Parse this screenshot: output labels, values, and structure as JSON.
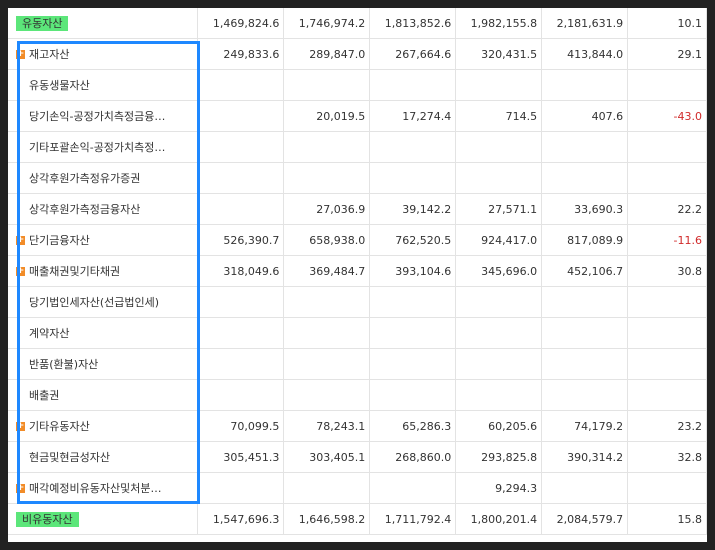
{
  "rows": [
    {
      "label": "유동자산",
      "expandable": false,
      "highlight": true,
      "values": [
        "1,469,824.6",
        "1,746,974.2",
        "1,813,852.6",
        "1,982,155.8",
        "2,181,631.9"
      ],
      "change": "10.1",
      "negative": false
    },
    {
      "label": "재고자산",
      "expandable": true,
      "highlight": false,
      "values": [
        "249,833.6",
        "289,847.0",
        "267,664.6",
        "320,431.5",
        "413,844.0"
      ],
      "change": "29.1",
      "negative": false
    },
    {
      "label": "유동생물자산",
      "expandable": false,
      "highlight": false,
      "values": [
        "",
        "",
        "",
        "",
        ""
      ],
      "change": "",
      "negative": false
    },
    {
      "label": "당기손익-공정가치측정금융…",
      "expandable": false,
      "highlight": false,
      "values": [
        "",
        "20,019.5",
        "17,274.4",
        "714.5",
        "407.6"
      ],
      "change": "-43.0",
      "negative": true
    },
    {
      "label": "기타포괄손익-공정가치측정…",
      "expandable": false,
      "highlight": false,
      "values": [
        "",
        "",
        "",
        "",
        ""
      ],
      "change": "",
      "negative": false
    },
    {
      "label": "상각후원가측정유가증권",
      "expandable": false,
      "highlight": false,
      "values": [
        "",
        "",
        "",
        "",
        ""
      ],
      "change": "",
      "negative": false
    },
    {
      "label": "상각후원가측정금융자산",
      "expandable": false,
      "highlight": false,
      "values": [
        "",
        "27,036.9",
        "39,142.2",
        "27,571.1",
        "33,690.3"
      ],
      "change": "22.2",
      "negative": false
    },
    {
      "label": "단기금융자산",
      "expandable": true,
      "highlight": false,
      "values": [
        "526,390.7",
        "658,938.0",
        "762,520.5",
        "924,417.0",
        "817,089.9"
      ],
      "change": "-11.6",
      "negative": true
    },
    {
      "label": "매출채권및기타채권",
      "expandable": true,
      "highlight": false,
      "values": [
        "318,049.6",
        "369,484.7",
        "393,104.6",
        "345,696.0",
        "452,106.7"
      ],
      "change": "30.8",
      "negative": false
    },
    {
      "label": "당기법인세자산(선급법인세)",
      "expandable": false,
      "highlight": false,
      "values": [
        "",
        "",
        "",
        "",
        ""
      ],
      "change": "",
      "negative": false
    },
    {
      "label": "계약자산",
      "expandable": false,
      "highlight": false,
      "values": [
        "",
        "",
        "",
        "",
        ""
      ],
      "change": "",
      "negative": false
    },
    {
      "label": "반품(환불)자산",
      "expandable": false,
      "highlight": false,
      "values": [
        "",
        "",
        "",
        "",
        ""
      ],
      "change": "",
      "negative": false
    },
    {
      "label": "배출권",
      "expandable": false,
      "highlight": false,
      "values": [
        "",
        "",
        "",
        "",
        ""
      ],
      "change": "",
      "negative": false
    },
    {
      "label": "기타유동자산",
      "expandable": true,
      "highlight": false,
      "values": [
        "70,099.5",
        "78,243.1",
        "65,286.3",
        "60,205.6",
        "74,179.2"
      ],
      "change": "23.2",
      "negative": false
    },
    {
      "label": "현금및현금성자산",
      "expandable": false,
      "highlight": false,
      "values": [
        "305,451.3",
        "303,405.1",
        "268,860.0",
        "293,825.8",
        "390,314.2"
      ],
      "change": "32.8",
      "negative": false
    },
    {
      "label": "매각예정비유동자산및처분…",
      "expandable": true,
      "highlight": false,
      "values": [
        "",
        "",
        "",
        "9,294.3",
        ""
      ],
      "change": "",
      "negative": false
    },
    {
      "label": "비유동자산",
      "expandable": false,
      "highlight": true,
      "values": [
        "1,547,696.3",
        "1,646,598.2",
        "1,711,792.4",
        "1,800,201.4",
        "2,084,579.7"
      ],
      "change": "15.8",
      "negative": false
    }
  ]
}
